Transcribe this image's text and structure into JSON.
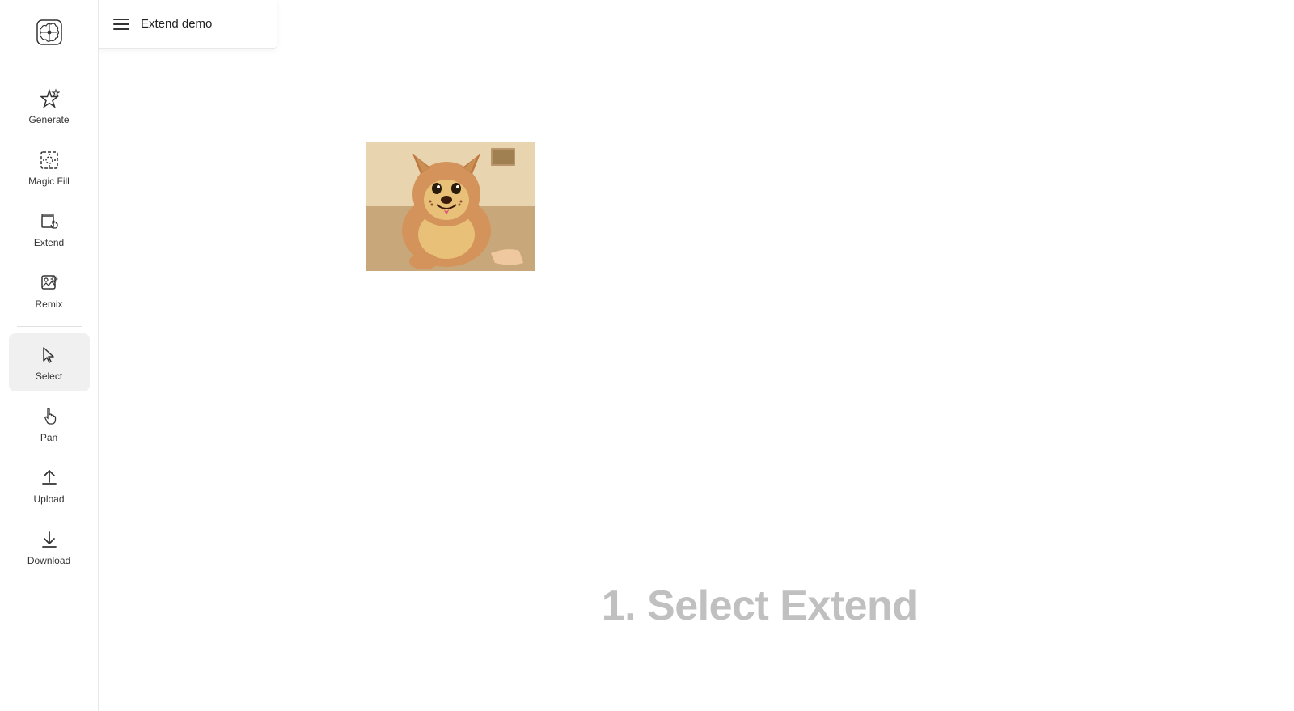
{
  "app": {
    "title": "Extend demo"
  },
  "sidebar": {
    "logo_alt": "AI Brain Logo",
    "items": [
      {
        "id": "generate",
        "label": "Generate",
        "icon": "generate-icon"
      },
      {
        "id": "magic-fill",
        "label": "Magic Fill",
        "icon": "magic-fill-icon"
      },
      {
        "id": "extend",
        "label": "Extend",
        "icon": "extend-icon"
      },
      {
        "id": "remix",
        "label": "Remix",
        "icon": "remix-icon"
      },
      {
        "id": "select",
        "label": "Select",
        "icon": "select-icon",
        "active": true
      },
      {
        "id": "pan",
        "label": "Pan",
        "icon": "pan-icon"
      },
      {
        "id": "upload",
        "label": "Upload",
        "icon": "upload-icon"
      },
      {
        "id": "download",
        "label": "Download",
        "icon": "download-icon"
      }
    ]
  },
  "canvas": {
    "instruction": "1. Select Extend"
  }
}
